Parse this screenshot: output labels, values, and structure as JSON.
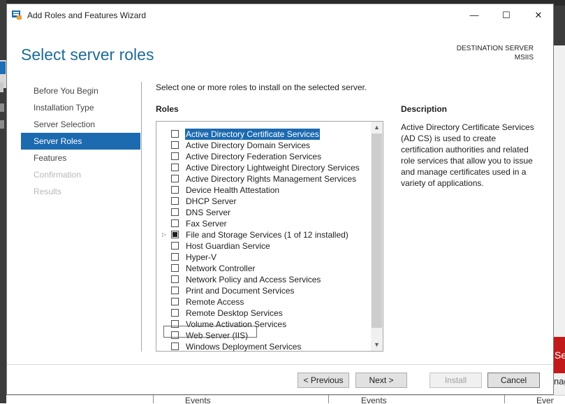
{
  "window": {
    "title": "Add Roles and Features Wizard",
    "minimize_glyph": "—",
    "maximize_glyph": "☐",
    "close_glyph": "✕"
  },
  "header": {
    "title": "Select server roles",
    "destination_label": "DESTINATION SERVER",
    "destination_server": "MSIIS"
  },
  "nav": {
    "items": [
      {
        "label": "Before You Begin",
        "state": "normal"
      },
      {
        "label": "Installation Type",
        "state": "normal"
      },
      {
        "label": "Server Selection",
        "state": "normal"
      },
      {
        "label": "Server Roles",
        "state": "active"
      },
      {
        "label": "Features",
        "state": "normal"
      },
      {
        "label": "Confirmation",
        "state": "disabled"
      },
      {
        "label": "Results",
        "state": "disabled"
      }
    ]
  },
  "content": {
    "instruction": "Select one or more roles to install on the selected server.",
    "roles_heading": "Roles",
    "description_heading": "Description",
    "description_text": "Active Directory Certificate Services (AD CS) is used to create certification authorities and related role services that allow you to issue and manage certificates used in a variety of applications.",
    "roles": [
      {
        "label": "Active Directory Certificate Services",
        "checked": false,
        "selected": true
      },
      {
        "label": "Active Directory Domain Services",
        "checked": false
      },
      {
        "label": "Active Directory Federation Services",
        "checked": false
      },
      {
        "label": "Active Directory Lightweight Directory Services",
        "checked": false
      },
      {
        "label": "Active Directory Rights Management Services",
        "checked": false
      },
      {
        "label": "Device Health Attestation",
        "checked": false
      },
      {
        "label": "DHCP Server",
        "checked": false
      },
      {
        "label": "DNS Server",
        "checked": false
      },
      {
        "label": "Fax Server",
        "checked": false
      },
      {
        "label": "File and Storage Services (1 of 12 installed)",
        "checked": "partial",
        "expandable": true
      },
      {
        "label": "Host Guardian Service",
        "checked": false
      },
      {
        "label": "Hyper-V",
        "checked": false
      },
      {
        "label": "Network Controller",
        "checked": false
      },
      {
        "label": "Network Policy and Access Services",
        "checked": false
      },
      {
        "label": "Print and Document Services",
        "checked": false
      },
      {
        "label": "Remote Access",
        "checked": false
      },
      {
        "label": "Remote Desktop Services",
        "checked": false
      },
      {
        "label": "Volume Activation Services",
        "checked": false
      },
      {
        "label": "Web Server (IIS)",
        "checked": false,
        "focused": true
      },
      {
        "label": "Windows Deployment Services",
        "checked": false
      }
    ]
  },
  "buttons": {
    "previous": "< Previous",
    "next": "Next >",
    "install": "Install",
    "cancel": "Cancel"
  },
  "background": {
    "events": [
      "Events",
      "Events",
      "Events"
    ],
    "right_banner_text": "Se",
    "right_text": "nag"
  },
  "colors": {
    "accent": "#1c6ab0",
    "title_blue": "#1c6b96",
    "banner_red": "#c21a1a"
  }
}
